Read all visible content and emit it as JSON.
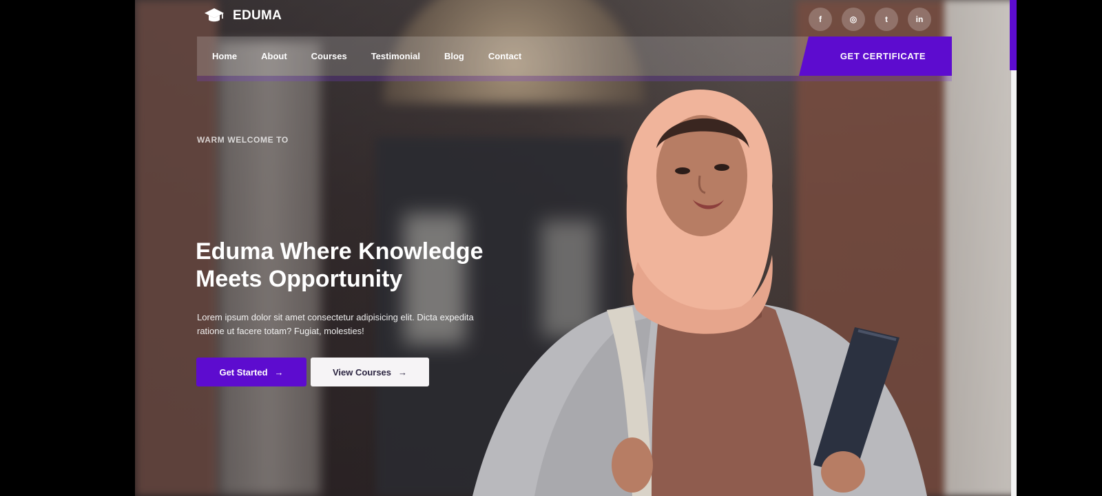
{
  "brand": {
    "name": "EDUMA",
    "icon": "graduation-cap-icon"
  },
  "socials": [
    {
      "name": "facebook",
      "glyph": "f"
    },
    {
      "name": "instagram",
      "glyph": "◎"
    },
    {
      "name": "twitter",
      "glyph": "t"
    },
    {
      "name": "linkedin",
      "glyph": "in"
    }
  ],
  "nav": {
    "items": [
      "Home",
      "About",
      "Courses",
      "Testimonial",
      "Blog",
      "Contact"
    ],
    "cta": "GET CERTIFICATE"
  },
  "hero": {
    "eyebrow": "WARM WELCOME TO",
    "title_line1": "Eduma Where Knowledge",
    "title_line2": "Meets Opportunity",
    "description": "Lorem ipsum dolor sit amet consectetur adipisicing elit. Dicta expedita ratione ut facere totam? Fugiat, molesties!",
    "primary_button": "Get Started",
    "secondary_button": "View Courses",
    "arrow": "→"
  },
  "colors": {
    "accent": "#5d0ccf",
    "button_light": "#f6f4f6",
    "text_light": "#ffffff"
  }
}
